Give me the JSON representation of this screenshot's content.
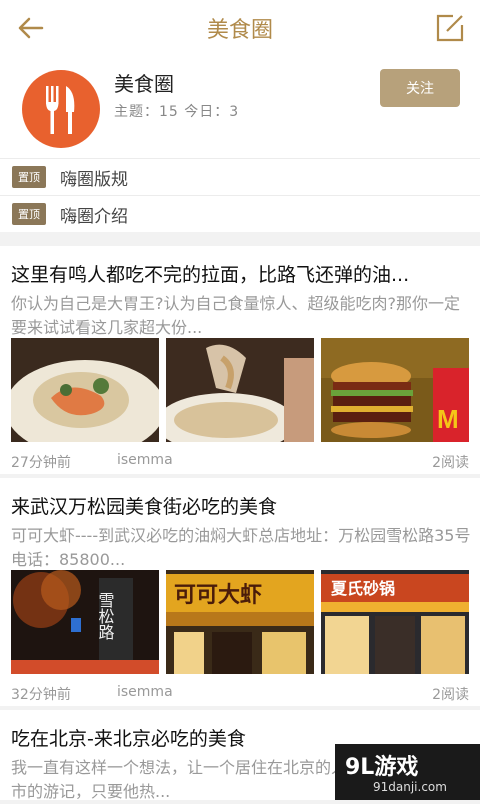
{
  "topbar": {
    "title": "美食圈"
  },
  "circle": {
    "name": "美食圈",
    "stats": "主题：15  今日：3",
    "follow_label": "关注"
  },
  "pinned": [
    {
      "tag": "置顶",
      "text": "嗨圈版规"
    },
    {
      "tag": "置顶",
      "text": "嗨圈介绍"
    }
  ],
  "posts": [
    {
      "title": "这里有鸣人都吃不完的拉面，比路飞还弹的油...",
      "desc": "你认为自己是大胃王?认为自己食量惊人、超级能吃肉?那你一定要来试试看这几家超大份...",
      "time": "27分钟前",
      "user": "isemma",
      "reads": "2阅读"
    },
    {
      "title": "来武汉万松园美食街必吃的美食",
      "desc": "可可大虾----到武汉必吃的油焖大虾总店地址：万松园雪松路35号电话：85800...",
      "time": "32分钟前",
      "user": "isemma",
      "reads": "2阅读",
      "img_text_1": "雪松路",
      "img_text_2": "可可大虾",
      "img_text_3": "夏氏砂锅"
    },
    {
      "title": "吃在北京-来北京必吃的美食",
      "desc": "我一直有这样一个想法，让一个居住在北京的人，写一篇自己城市的游记，只要他热..."
    }
  ],
  "watermark": {
    "brand": "9L游戏",
    "url": "91danji.com"
  }
}
